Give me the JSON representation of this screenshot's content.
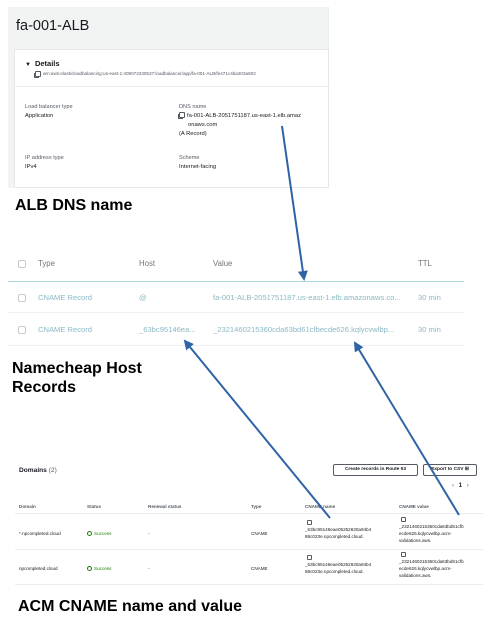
{
  "alb": {
    "title": "fa-001-ALB",
    "details_header": "Details",
    "arn": "arn:aws:elasticloadbalancing:us-east-1:409072330537:loadbalancer/app/fa-001-ALB/fe471c4ba203a602",
    "fields": {
      "lb_type_label": "Load balancer type",
      "lb_type_value": "Application",
      "dns_label": "DNS name",
      "dns_value_line1": "fa-001-ALB-2051751187.us-east-1.elb.amaz",
      "dns_value_line2": "onaws.com",
      "dns_value_line3": "(A Record)",
      "ip_label": "IP address type",
      "ip_value": "IPv4",
      "scheme_label": "Scheme",
      "scheme_value": "Internet-facing"
    }
  },
  "headings": {
    "alb_dns": "ALB DNS name",
    "namecheap_line1": "Namecheap Host",
    "namecheap_line2": "Records",
    "acm": "ACM CNAME name and value"
  },
  "namecheap": {
    "columns": [
      "Type",
      "Host",
      "Value",
      "TTL"
    ],
    "rows": [
      {
        "type": "CNAME Record",
        "host": "@",
        "value": "fa-001-ALB-2051751187.us-east-1.elb.amazonaws.co...",
        "ttl": "30 min"
      },
      {
        "type": "CNAME Record",
        "host": "_63bc95146ea...",
        "value": "_2321460215360cda63bd61cfbecde626.kqlycvwlbp...",
        "ttl": "30 min"
      }
    ]
  },
  "acm": {
    "title": "Domains",
    "count": "(2)",
    "btn_route53": "Create records in Route 53",
    "btn_export": "Export to CSV",
    "page": "1",
    "columns": [
      "Domain",
      "Status",
      "Renewal status",
      "Type",
      "CNAME name",
      "CNAME value"
    ],
    "rows": [
      {
        "domain": "*.npcompleted.cloud",
        "status": "Success",
        "renewal": "-",
        "type": "CNAME",
        "cname_name_1": "_63bc95146eae05252630a94b4",
        "cname_name_2": "88c023e.npcompleted.cloud.",
        "cname_value_1": "_2321460215360cda63bd61cfb",
        "cname_value_2": "ecde626.kqlycvwlbp.acm-",
        "cname_value_3": "validations.aws."
      },
      {
        "domain": "npcompleted.cloud",
        "status": "Success",
        "renewal": "-",
        "type": "CNAME",
        "cname_name_1": "_63bc95146eae05252630a94b4",
        "cname_name_2": "88c023e.npcompleted.cloud.",
        "cname_value_1": "_2321460215360cda63bd61cfb",
        "cname_value_2": "ecde626.kqlycvwlbp.acm-",
        "cname_value_3": "validations.aws."
      }
    ]
  },
  "colors": {
    "arrow": "#2f63a6",
    "success": "#1d8102",
    "namecheap_text": "#8cb9c4"
  }
}
